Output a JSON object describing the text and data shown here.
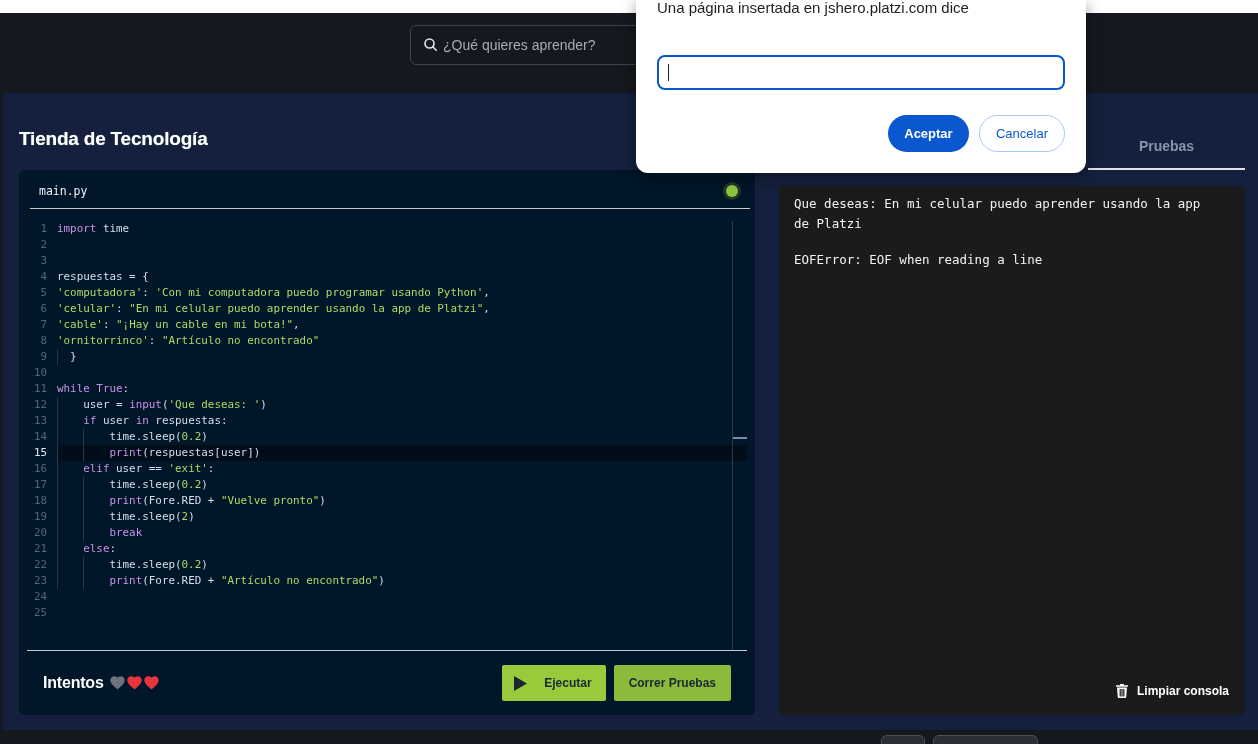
{
  "header": {
    "search": {
      "placeholder": "¿Qué quieres aprender?"
    }
  },
  "dialog": {
    "message": "Una página insertada en jshero.platzi.com dice",
    "input": {
      "focused": true
    },
    "buttons": [
      {
        "label": "Aceptar",
        "kind": "primary"
      },
      {
        "label": "Cancelar",
        "kind": "secondary"
      }
    ]
  },
  "exercise": {
    "title": "Tienda de Tecnología",
    "tabs": [
      {
        "label": "Pruebas",
        "selected": false
      }
    ]
  },
  "editor": {
    "filename": "main.py",
    "lines": [
      {
        "number": "1",
        "active": false,
        "tokens": [
          {
            "text": "import",
            "kind": "keyword"
          },
          {
            "text": " time",
            "kind": "plain"
          }
        ]
      },
      {
        "number": "2",
        "active": false
      },
      {
        "number": "3",
        "active": false
      },
      {
        "number": "4",
        "active": false,
        "tokens": [
          {
            "text": "respuestas = {",
            "kind": "plain"
          }
        ]
      },
      {
        "number": "5",
        "active": false,
        "tokens": [
          {
            "text": "'computadora'",
            "kind": "string"
          },
          {
            "text": ": ",
            "kind": "plain"
          },
          {
            "text": "'Con mi computadora puedo programar usando Python'",
            "kind": "string"
          },
          {
            "text": ",",
            "kind": "plain"
          }
        ]
      },
      {
        "number": "6",
        "active": false,
        "tokens": [
          {
            "text": "'celular'",
            "kind": "string"
          },
          {
            "text": ": ",
            "kind": "plain"
          },
          {
            "text": "\"En mi celular puedo aprender usando la app de Platzi\"",
            "kind": "string"
          },
          {
            "text": ",",
            "kind": "plain"
          }
        ]
      },
      {
        "number": "7",
        "active": false,
        "tokens": [
          {
            "text": "'cable'",
            "kind": "string"
          },
          {
            "text": ": ",
            "kind": "plain"
          },
          {
            "text": "\"¡Hay un cable en mi bota!\"",
            "kind": "string"
          },
          {
            "text": ",",
            "kind": "plain"
          }
        ]
      },
      {
        "number": "8",
        "active": false,
        "tokens": [
          {
            "text": "'ornitorrinco'",
            "kind": "string"
          },
          {
            "text": ": ",
            "kind": "plain"
          },
          {
            "text": "\"Artículo no encontrado\"",
            "kind": "string"
          }
        ]
      },
      {
        "number": "9",
        "active": false,
        "tokens": [
          {
            "text": "  }",
            "kind": "plain"
          }
        ]
      },
      {
        "number": "10",
        "active": false
      },
      {
        "number": "11",
        "active": false,
        "tokens": [
          {
            "text": "while",
            "kind": "keyword"
          },
          {
            "text": " True",
            "kind": "keyword"
          },
          {
            "text": ":",
            "kind": "plain"
          }
        ]
      },
      {
        "number": "12",
        "active": false,
        "tokens": [
          {
            "text": "    user = ",
            "kind": "plain"
          },
          {
            "text": "input",
            "kind": "keyword"
          },
          {
            "text": "(",
            "kind": "plain"
          },
          {
            "text": "'Que deseas: '",
            "kind": "string"
          },
          {
            "text": ")",
            "kind": "plain"
          }
        ]
      },
      {
        "number": "13",
        "active": false,
        "tokens": [
          {
            "text": "    if",
            "kind": "keyword"
          },
          {
            "text": " user ",
            "kind": "plain"
          },
          {
            "text": "in",
            "kind": "keyword"
          },
          {
            "text": " respuestas:",
            "kind": "plain"
          }
        ]
      },
      {
        "number": "14",
        "active": false,
        "tokens": [
          {
            "text": "        time.sleep(",
            "kind": "plain"
          },
          {
            "text": "0.2",
            "kind": "number"
          },
          {
            "text": ")",
            "kind": "plain"
          }
        ]
      },
      {
        "number": "15",
        "active": true,
        "tokens": [
          {
            "text": "        print",
            "kind": "keyword"
          },
          {
            "text": "(respuestas[user])",
            "kind": "plain"
          }
        ]
      },
      {
        "number": "16",
        "active": false,
        "tokens": [
          {
            "text": "    elif",
            "kind": "keyword"
          },
          {
            "text": " user == ",
            "kind": "plain"
          },
          {
            "text": "'exit'",
            "kind": "string"
          },
          {
            "text": ":",
            "kind": "plain"
          }
        ]
      },
      {
        "number": "17",
        "active": false,
        "tokens": [
          {
            "text": "        time.sleep(",
            "kind": "plain"
          },
          {
            "text": "0.2",
            "kind": "number"
          },
          {
            "text": ")",
            "kind": "plain"
          }
        ]
      },
      {
        "number": "18",
        "active": false,
        "tokens": [
          {
            "text": "        print",
            "kind": "keyword"
          },
          {
            "text": "(Fore.RED + ",
            "kind": "plain"
          },
          {
            "text": "\"Vuelve pronto\"",
            "kind": "string"
          },
          {
            "text": ")",
            "kind": "plain"
          }
        ]
      },
      {
        "number": "19",
        "active": false,
        "tokens": [
          {
            "text": "        time.sleep(",
            "kind": "plain"
          },
          {
            "text": "2",
            "kind": "number"
          },
          {
            "text": ")",
            "kind": "plain"
          }
        ]
      },
      {
        "number": "20",
        "active": false,
        "tokens": [
          {
            "text": "        break",
            "kind": "keyword"
          }
        ]
      },
      {
        "number": "21",
        "active": false,
        "tokens": [
          {
            "text": "    else",
            "kind": "keyword"
          },
          {
            "text": ":",
            "kind": "plain"
          }
        ]
      },
      {
        "number": "22",
        "active": false,
        "tokens": [
          {
            "text": "        time.sleep(",
            "kind": "plain"
          },
          {
            "text": "0.2",
            "kind": "number"
          },
          {
            "text": ")",
            "kind": "plain"
          }
        ]
      },
      {
        "number": "23",
        "active": false,
        "tokens": [
          {
            "text": "        print",
            "kind": "keyword"
          },
          {
            "text": "(Fore.RED + ",
            "kind": "plain"
          },
          {
            "text": "\"Artículo no encontrado\"",
            "kind": "string"
          },
          {
            "text": ")",
            "kind": "plain"
          }
        ]
      },
      {
        "number": "24",
        "active": false
      },
      {
        "number": "25",
        "active": false
      }
    ]
  },
  "footer": {
    "label": "Intentos",
    "lives": [
      {
        "lost": true
      },
      {
        "lost": false
      },
      {
        "lost": false
      }
    ],
    "actions": [
      {
        "label": "Ejecutar",
        "kind": "run"
      },
      {
        "label": "Correr Pruebas",
        "kind": "test"
      }
    ]
  },
  "console": {
    "output": [
      "Que deseas: En mi celular puedo aprender usando la app de Platzi",
      "EOFError: EOF when reading a line"
    ],
    "clear_button": {
      "label": "Limpiar consola"
    }
  }
}
